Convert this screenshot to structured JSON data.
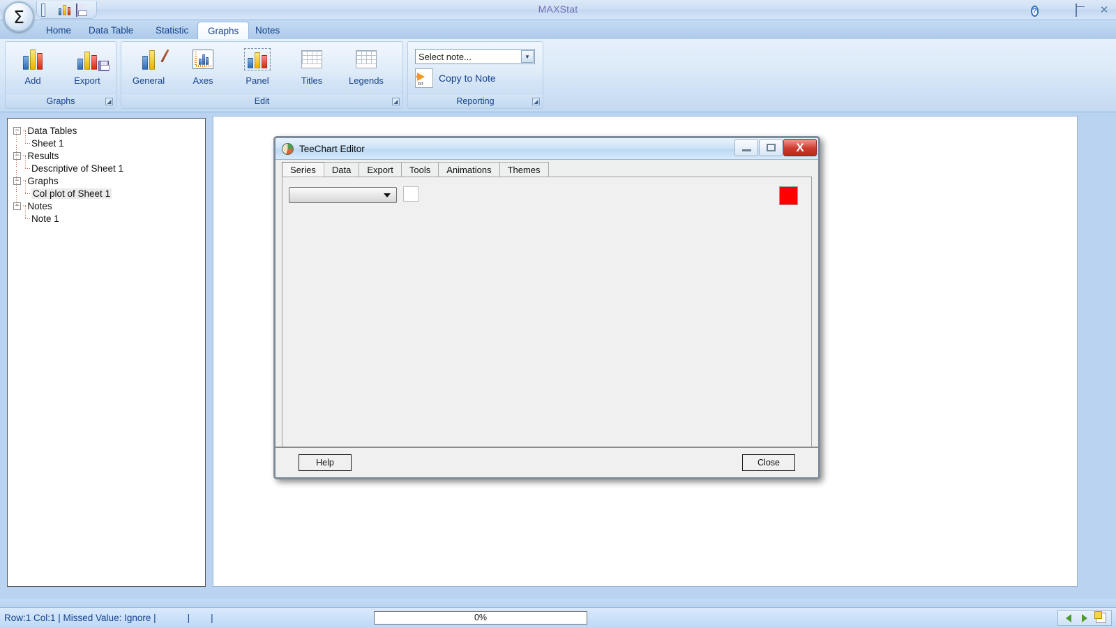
{
  "window": {
    "app_title": "MAXStat",
    "quick_access": [
      "calculator-icon",
      "chart-icon",
      "save-icon"
    ],
    "controls": {
      "help": "?",
      "minimize": "_",
      "restore": "❐",
      "close": "×"
    },
    "logo_glyph": "Σ"
  },
  "ribbon": {
    "tabs": [
      {
        "label": "Home",
        "active": false
      },
      {
        "label": "Data Table",
        "active": false
      },
      {
        "label": "Statistic",
        "active": false
      },
      {
        "label": "Graphs",
        "active": true
      },
      {
        "label": "Notes",
        "active": false
      }
    ],
    "groups": [
      {
        "title": "Graphs",
        "buttons": [
          {
            "label": "Add",
            "icon": "bar-chart-icon"
          },
          {
            "label": "Export",
            "icon": "bar-chart-save-icon"
          }
        ]
      },
      {
        "title": "Edit",
        "buttons": [
          {
            "label": "General",
            "icon": "chart-brush-icon"
          },
          {
            "label": "Axes",
            "icon": "axes-icon"
          },
          {
            "label": "Panel",
            "icon": "panel-icon"
          },
          {
            "label": "Titles",
            "icon": "table-grid-icon"
          },
          {
            "label": "Legends",
            "icon": "table-grid-icon"
          }
        ]
      },
      {
        "title": "Reporting",
        "note_select": {
          "value": "Select note...",
          "placeholder": "Select note..."
        },
        "copy_to_note": {
          "label": "Copy to Note",
          "icon": "txt-arrow-icon"
        }
      }
    ]
  },
  "tree": {
    "nodes": [
      {
        "label": "Data Tables",
        "level": 1,
        "expanded": true,
        "selected": false
      },
      {
        "label": "Sheet 1",
        "level": 2,
        "expanded": false,
        "selected": false
      },
      {
        "label": "Results",
        "level": 1,
        "expanded": true,
        "selected": false
      },
      {
        "label": "Descriptive of Sheet 1",
        "level": 2,
        "expanded": false,
        "selected": false
      },
      {
        "label": "Graphs",
        "level": 1,
        "expanded": true,
        "selected": false
      },
      {
        "label": "Col plot of Sheet 1",
        "level": 2,
        "expanded": false,
        "selected": true
      },
      {
        "label": "Notes",
        "level": 1,
        "expanded": true,
        "selected": false
      },
      {
        "label": "Note 1",
        "level": 2,
        "expanded": false,
        "selected": false
      }
    ]
  },
  "dialog": {
    "title": "TeeChart Editor",
    "icon": "pie-chart-icon",
    "controls": {
      "minimize": "",
      "maximize": "",
      "close": "X"
    },
    "tabs": [
      {
        "label": "Series",
        "active": true
      },
      {
        "label": "Data",
        "active": false
      },
      {
        "label": "Export",
        "active": false
      },
      {
        "label": "Tools",
        "active": false
      },
      {
        "label": "Animations",
        "active": false
      },
      {
        "label": "Themes",
        "active": false
      }
    ],
    "series_combo": {
      "value": "",
      "placeholder": ""
    },
    "series_color": "#fe0000",
    "buttons": {
      "help": "Help",
      "close": "Close"
    }
  },
  "statusbar": {
    "text": "Row:1 Col:1 | Missed Value: Ignore |            |        |",
    "progress_label": "0%",
    "progress_percent": 0,
    "nav": [
      "back-arrow-icon",
      "forward-arrow-icon",
      "new-document-icon"
    ]
  }
}
